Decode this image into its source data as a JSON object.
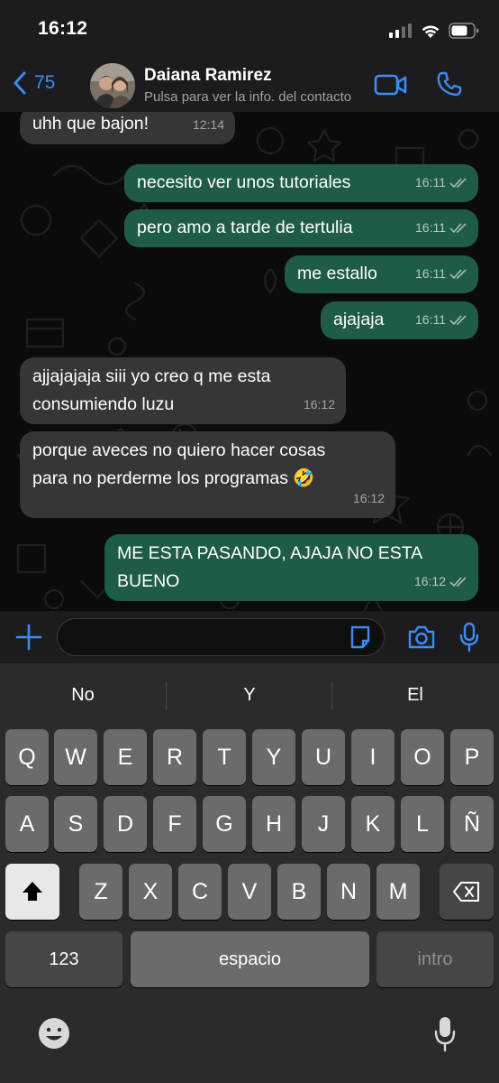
{
  "status": {
    "time": "16:12"
  },
  "header": {
    "back_count": "75",
    "contact_name": "Daiana Ramirez",
    "contact_subtitle": "Pulsa para ver la info. del contacto"
  },
  "messages": [
    {
      "direction": "in",
      "text": "uhh que bajon!",
      "time": "12:14"
    },
    {
      "direction": "out",
      "text": "necesito ver unos tutoriales",
      "time": "16:11"
    },
    {
      "direction": "out",
      "text": "pero amo a tarde de tertulia",
      "time": "16:11"
    },
    {
      "direction": "out",
      "text": "me estallo",
      "time": "16:11"
    },
    {
      "direction": "out",
      "text": "ajajaja",
      "time": "16:11"
    },
    {
      "direction": "in",
      "text_line1": "ajjajajaja siii yo creo q me esta",
      "text_line2": "consumiendo luzu",
      "time": "16:12"
    },
    {
      "direction": "in",
      "text_line1": "porque aveces no quiero hacer cosas",
      "text_line2": "para no perderme los programas",
      "emoji": "🤣",
      "time": "16:12"
    },
    {
      "direction": "out",
      "text_line1": "ME ESTA PASANDO, AJAJA NO ESTA",
      "text_line2": "BUENO",
      "time": "16:12"
    }
  ],
  "keyboard": {
    "suggestions": [
      "No",
      "Y",
      "El"
    ],
    "row1": [
      "Q",
      "W",
      "E",
      "R",
      "T",
      "Y",
      "U",
      "I",
      "O",
      "P"
    ],
    "row2": [
      "A",
      "S",
      "D",
      "F",
      "G",
      "H",
      "J",
      "K",
      "L",
      "Ñ"
    ],
    "row3": [
      "Z",
      "X",
      "C",
      "V",
      "B",
      "N",
      "M"
    ],
    "numbers_label": "123",
    "space_label": "espacio",
    "enter_label": "intro"
  },
  "icons": {
    "back": "chevron-left-icon",
    "video": "video-camera-icon",
    "call": "phone-icon",
    "plus": "plus-icon",
    "sticker": "sticker-icon",
    "camera": "camera-icon",
    "mic": "microphone-icon",
    "shift": "shift-arrow-icon",
    "delete": "backspace-icon",
    "emoji": "emoji-face-icon",
    "dictation": "dictation-mic-icon",
    "read_receipt": "double-check-icon"
  },
  "colors": {
    "accent": "#3b8cf3",
    "outgoing_bubble": "#1e5c47",
    "incoming_bubble": "#363638"
  }
}
